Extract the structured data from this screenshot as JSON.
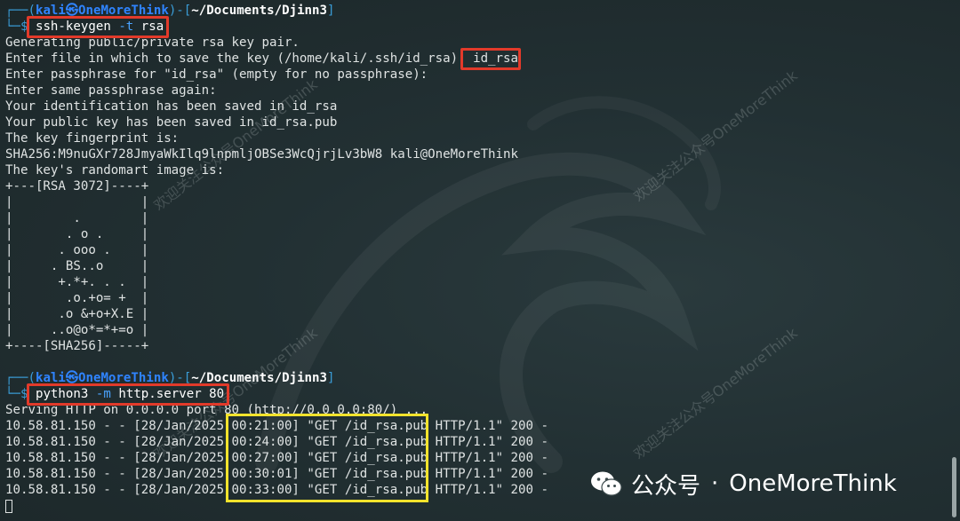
{
  "prompt1": {
    "top_frame": "┌──(",
    "user": "kali㉿OneMoreThink",
    "mid": ")-[",
    "path": "~/Documents/Djinn3",
    "end": "]",
    "bottom_frame": "└─$ ",
    "cmd": "ssh-keygen",
    "flag": "-t",
    "arg": "rsa"
  },
  "output1": [
    "Generating public/private rsa key pair.",
    "Enter file in which to save the key (/home/kali/.ssh/id_rsa): id_rsa",
    "Enter passphrase for \"id_rsa\" (empty for no passphrase):",
    "Enter same passphrase again:",
    "Your identification has been saved in id_rsa",
    "Your public key has been saved in id_rsa.pub",
    "The key fingerprint is:",
    "SHA256:M9nuGXr728JmyaWkIlq9lnpmljOBSe3WcQjrjLv3bW8 kali@OneMoreThink",
    "The key's randomart image is:",
    "+---[RSA 3072]----+",
    "|                 |",
    "|        .        |",
    "|       . o .     |",
    "|      . ooo .    |",
    "|     . BS..o     |",
    "|      +.*+. . .  |",
    "|       .o.+o= +  |",
    "|      .o &+o+X.E |",
    "|     ..o@o*=*+=o |",
    "+----[SHA256]-----+"
  ],
  "prompt2": {
    "top_frame": "┌──(",
    "user": "kali㉿OneMoreThink",
    "mid": ")-[",
    "path": "~/Documents/Djinn3",
    "end": "]",
    "bottom_frame": "└─$ ",
    "cmd": "python3",
    "flag": "-m",
    "arg": "http.server 80"
  },
  "output2": [
    "Serving HTTP on 0.0.0.0 port 80 (http://0.0.0.0:80/) ...",
    "10.58.81.150 - - [28/Jan/2025 00:21:00] \"GET /id_rsa.pub HTTP/1.1\" 200 -",
    "10.58.81.150 - - [28/Jan/2025 00:24:00] \"GET /id_rsa.pub HTTP/1.1\" 200 -",
    "10.58.81.150 - - [28/Jan/2025 00:27:00] \"GET /id_rsa.pub HTTP/1.1\" 200 -",
    "10.58.81.150 - - [28/Jan/2025 00:30:01] \"GET /id_rsa.pub HTTP/1.1\" 200 -",
    "10.58.81.150 - - [28/Jan/2025 00:33:00] \"GET /id_rsa.pub HTTP/1.1\" 200 -"
  ],
  "watermark": {
    "text": "欢迎关注公众号OneMoreThink",
    "brand_label": "公众号",
    "dot": "·",
    "brand_name": "OneMoreThink",
    "icon": "wechat-icon"
  },
  "colors": {
    "highlight_red": "#e23a2a",
    "highlight_yellow": "#f2e32c",
    "prompt_blue": "#2f84ff"
  }
}
